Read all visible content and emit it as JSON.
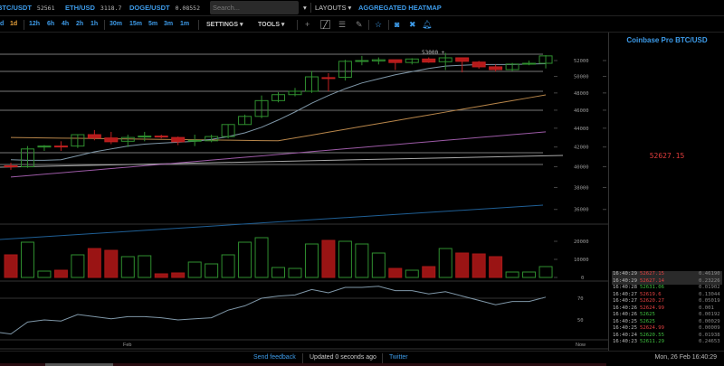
{
  "tickers": [
    {
      "symbol": "BTC/USDT",
      "price": "52561"
    },
    {
      "symbol": "ETH/USD",
      "price": "3118.7"
    },
    {
      "symbol": "DOGE/USDT",
      "price": "0.08552"
    }
  ],
  "search": {
    "placeholder": "Search...",
    "value": ""
  },
  "header": {
    "layouts": "LAYOUTS",
    "heatmap": "AGGREGATED HEATMAP"
  },
  "timeframes": [
    "d",
    "1d",
    "12h",
    "6h",
    "4h",
    "2h",
    "1h",
    "30m",
    "15m",
    "5m",
    "3m",
    "1m"
  ],
  "active_timeframe": "1d",
  "menus": {
    "settings": "SETTINGS",
    "tools": "TOOLS"
  },
  "icons": [
    "crosshair-icon",
    "trendline-icon",
    "horizontal-lines-icon",
    "brush-icon",
    "star-icon",
    "camera-icon",
    "fullscreen-icon",
    "bell-icon"
  ],
  "colors": {
    "accent": "#3d9be9",
    "up": "#2f8f2f",
    "down": "#b51a1a",
    "ma_fast": "#7f97a8",
    "ma_mid": "#b8864a",
    "ma_slow": "#9c5aa6",
    "ma_long": "#1f5f95"
  },
  "chart_data": {
    "type": "candlestick",
    "price_axis": {
      "ticks": [
        52000,
        50000,
        48000,
        46000,
        44000,
        42000,
        40000,
        38000,
        36000
      ],
      "scale": "log"
    },
    "price_marker": "53000",
    "x_labels": [
      "Feb",
      "Now"
    ],
    "candles": [
      [
        40100,
        40400,
        39700,
        40000
      ],
      [
        40000,
        42100,
        39900,
        41800
      ],
      [
        42000,
        42200,
        41600,
        42100
      ],
      [
        42100,
        42600,
        41600,
        42050
      ],
      [
        42100,
        43300,
        41900,
        43300
      ],
      [
        43300,
        43800,
        42700,
        42950
      ],
      [
        42950,
        43600,
        42300,
        42550
      ],
      [
        42600,
        43300,
        42000,
        43000
      ],
      [
        43100,
        43600,
        42600,
        43150
      ],
      [
        43150,
        43300,
        42900,
        43050
      ],
      [
        43000,
        43100,
        42200,
        42550
      ],
      [
        42650,
        43300,
        42100,
        42700
      ],
      [
        42650,
        43300,
        42500,
        43100
      ],
      [
        43100,
        44400,
        42900,
        44400
      ],
      [
        44400,
        45500,
        44400,
        45300
      ],
      [
        45300,
        47700,
        45100,
        47100
      ],
      [
        47100,
        48100,
        46900,
        47800
      ],
      [
        47800,
        48600,
        47600,
        48200
      ],
      [
        48200,
        50700,
        48000,
        49950
      ],
      [
        49850,
        50400,
        48200,
        49800
      ],
      [
        49900,
        52100,
        49500,
        51900
      ],
      [
        51950,
        52600,
        51400,
        52000
      ],
      [
        51950,
        52400,
        51500,
        52100
      ],
      [
        52100,
        52100,
        50800,
        51750
      ],
      [
        51750,
        52300,
        51500,
        52200
      ],
      [
        52200,
        52400,
        51700,
        51800
      ],
      [
        51850,
        53000,
        50800,
        52350
      ],
      [
        52350,
        52400,
        50500,
        51900
      ],
      [
        51800,
        51950,
        50950,
        51200
      ],
      [
        51200,
        51500,
        50600,
        50850
      ],
      [
        50850,
        51700,
        50650,
        51550
      ],
      [
        51600,
        52000,
        51400,
        51650
      ],
      [
        51650,
        52700,
        51000,
        52600
      ]
    ],
    "ma_fast": [
      40700,
      40650,
      40650,
      40700,
      41100,
      41500,
      41800,
      42100,
      42300,
      42400,
      42500,
      42600,
      42800,
      43100,
      43500,
      44100,
      44900,
      45800,
      46800,
      47700,
      48500,
      49200,
      49700,
      50200,
      50600,
      51000,
      51300,
      51400,
      51500,
      51500,
      51500,
      51550,
      51600
    ],
    "ma_mid_range": [
      43000,
      47770
    ],
    "ma_slow_range": [
      39000,
      43600
    ],
    "volume": {
      "ticks": [
        20000,
        10000,
        0
      ],
      "values": [
        12500,
        19500,
        3500,
        4000,
        12500,
        16000,
        15000,
        11500,
        12000,
        2000,
        2500,
        8500,
        7500,
        12500,
        19500,
        22000,
        5500,
        5000,
        18500,
        20500,
        20000,
        18500,
        13500,
        5000,
        4000,
        6000,
        16000,
        13500,
        13000,
        11500,
        3000,
        3000,
        6000
      ]
    },
    "oscillator": {
      "ticks": [
        70,
        50
      ],
      "values": [
        37,
        48,
        50,
        49,
        55,
        53,
        51,
        53,
        53,
        52,
        50,
        51,
        52,
        59,
        63,
        70,
        72,
        73,
        78,
        75,
        80,
        80,
        81,
        77,
        77,
        74,
        76,
        72,
        68,
        64,
        67,
        67,
        71
      ]
    }
  },
  "sidebar": {
    "title": "Coinbase Pro BTC/USD",
    "last_price": "52627.15",
    "trades": [
      {
        "time": "16:40:29",
        "price": "52627.15",
        "size": "0.46190",
        "side": "dn",
        "hl": true
      },
      {
        "time": "16:40:29",
        "price": "52627.14",
        "size": "0.23226",
        "side": "dn",
        "hl": true
      },
      {
        "time": "16:40:28",
        "price": "52631.06",
        "size": "0.01902",
        "side": "up"
      },
      {
        "time": "16:40:27",
        "price": "52619.6",
        "size": "0.13044",
        "side": "dn"
      },
      {
        "time": "16:40:27",
        "price": "52620.27",
        "size": "0.05019",
        "side": "dn"
      },
      {
        "time": "16:40:26",
        "price": "52624.99",
        "size": "0.001",
        "side": "dn"
      },
      {
        "time": "16:40:26",
        "price": "52625",
        "size": "0.00192",
        "side": "up"
      },
      {
        "time": "16:40:25",
        "price": "52625",
        "size": "0.00029",
        "side": "up"
      },
      {
        "time": "16:40:25",
        "price": "52624.99",
        "size": "0.00009",
        "side": "dn"
      },
      {
        "time": "16:40:24",
        "price": "52620.55",
        "size": "0.01938",
        "side": "up"
      },
      {
        "time": "16:40:23",
        "price": "52611.29",
        "size": "0.24653",
        "side": "up"
      }
    ]
  },
  "footer": {
    "feedback": "Send feedback",
    "updated": "Updated 0 seconds ago",
    "twitter": "Twitter",
    "datetime": "Mon, 26 Feb 16:40:29"
  }
}
